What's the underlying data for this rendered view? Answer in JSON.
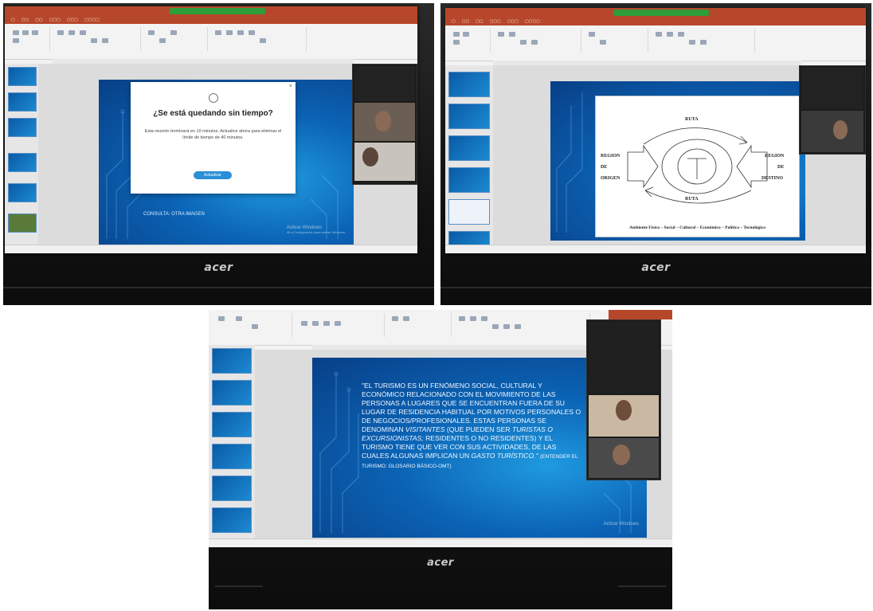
{
  "photo1": {
    "modal": {
      "title": "¿Se está quedando sin tiempo?",
      "body": "Esta reunión terminará en 10 minutos. Actualice ahora para eliminar el límite de tiempo de 40 minutos.",
      "button": "Actualizar"
    },
    "slide_fragment": "CONSULTA: OTRA IMAGEN",
    "activate": "Activar Windows",
    "activate_sub": "Ve a Configuración para activar Windows.",
    "brand": "acer"
  },
  "photo2": {
    "diagram": {
      "top": "RUTA",
      "bottom": "RUTA",
      "left_1": "REGION",
      "left_2": "DE",
      "left_3": "ORIGEN",
      "right_1": "REGION",
      "right_2": "DE",
      "right_3": "DESTINO",
      "footer": "Ambiente Físico – Social – Cultural – Económico – Político – Tecnológico"
    },
    "brand": "acer"
  },
  "photo3": {
    "quote_part1": "\"EL TURISMO ES UN FENÓMENO SOCIAL, CULTURAL Y ECONÓMICO RELACIONADO CON EL MOVIMIENTO DE LAS PERSONAS A LUGARES QUE SE ENCUENTRAN FUERA DE SU LUGAR DE RESIDENCIA HABITUAL POR MOTIVOS PERSONALES O DE NEGOCIOS/PROFESIONALES. ESTAS PERSONAS SE DENOMINAN",
    "quote_em1": "VISITANTES",
    "quote_part2": "(QUE PUEDEN SER",
    "quote_em2": "TURISTAS O EXCURSIONISTAS;",
    "quote_part3": "RESIDENTES O NO RESIDENTES) Y EL TURISMO TIENE QUE VER CON SUS ACTIVIDADES, DE LAS CUALES ALGUNAS IMPLICAN UN",
    "quote_em3": "GASTO TURÍSTICO.\"",
    "quote_source": "(ENTENDER EL TURISMO: GLOSARIO BÁSICO-OMT)",
    "activate": "Activar Windows",
    "brand": "acer"
  },
  "colors": {
    "ppt_red": "#b7472a",
    "slide_blue": "#0b63b5",
    "zoom_green": "#2e9d3a",
    "button_blue": "#2a8fd6"
  }
}
